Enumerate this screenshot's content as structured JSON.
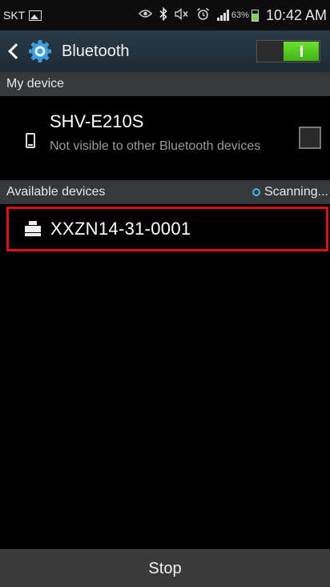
{
  "status_bar": {
    "carrier": "SKT",
    "battery_percent": "63%",
    "battery_level": 0.63,
    "time": "10:42 AM",
    "icons": [
      "image-notification-icon",
      "eye-icon",
      "bluetooth-icon",
      "mute-icon",
      "alarm-icon",
      "signal-icon",
      "battery-icon"
    ]
  },
  "action_bar": {
    "title": "Bluetooth",
    "toggle_on": true,
    "accent_color": "#4fd01b"
  },
  "my_device": {
    "header": "My device",
    "name": "SHV-E210S",
    "visibility": "Not visible to other Bluetooth devices",
    "visible_checked": false
  },
  "available": {
    "header": "Available devices",
    "status": "Scanning...",
    "devices": [
      {
        "name": "XXZN14-31-0001",
        "icon": "printer-icon"
      }
    ]
  },
  "bottom_bar": {
    "button_label": "Stop"
  },
  "highlight_color": "#e01010"
}
